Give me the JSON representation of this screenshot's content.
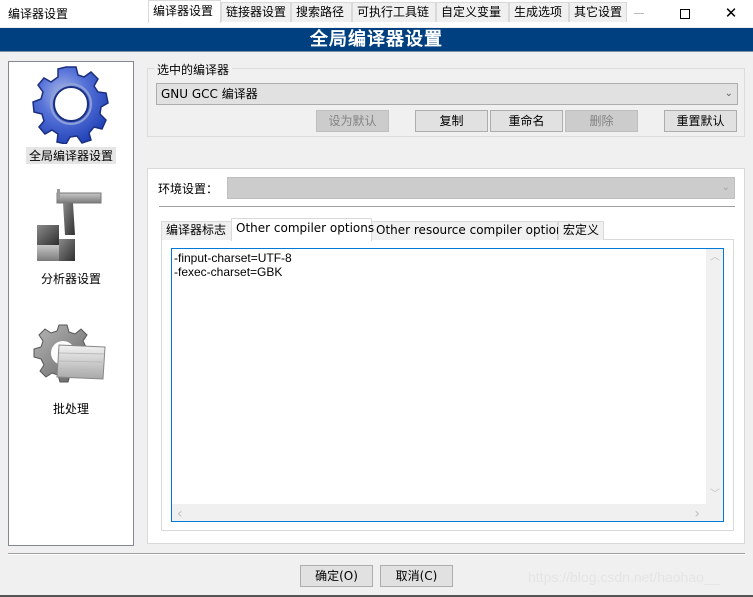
{
  "window": {
    "title": "编译器设置",
    "minimize_icon": "minimize-icon",
    "maximize_icon": "maximize-icon",
    "close_icon": "close-icon",
    "close_glyph": "✕"
  },
  "banner": {
    "title": "全局编译器设置"
  },
  "colors": {
    "banner": "#004080",
    "focus_border": "#0078d7"
  },
  "leftnav": {
    "items": [
      {
        "label": "全局编译器设置",
        "icon": "gear-icon",
        "selected": true
      },
      {
        "label": "分析器设置",
        "icon": "caliper-icon",
        "selected": false
      },
      {
        "label": "批处理",
        "icon": "batch-gear-icon",
        "selected": false
      }
    ]
  },
  "compiler_group": {
    "title": "选中的编译器",
    "selected_compiler": "GNU GCC 编译器",
    "chevron": "⌄",
    "buttons": {
      "set_default": "设为默认",
      "copy": "复制",
      "rename": "重命名",
      "delete": "删除",
      "reset_defaults": "重置默认"
    }
  },
  "main_tabs": [
    {
      "label": "编译器设置",
      "active": true
    },
    {
      "label": "链接器设置",
      "active": false
    },
    {
      "label": "搜索路径",
      "active": false
    },
    {
      "label": "可执行工具链",
      "active": false
    },
    {
      "label": "自定义变量",
      "active": false
    },
    {
      "label": "生成选项",
      "active": false
    },
    {
      "label": "其它设置",
      "active": false
    }
  ],
  "env": {
    "label": "环境设置：",
    "value": ""
  },
  "sub_tabs": [
    {
      "label": "编译器标志",
      "active": false
    },
    {
      "label": "Other compiler options",
      "active": true
    },
    {
      "label": "Other resource compiler options",
      "active": false
    },
    {
      "label": "宏定义",
      "active": false
    }
  ],
  "options_text": "-finput-charset=UTF-8\n-fexec-charset=GBK",
  "scroll_arrows": {
    "up": "︿",
    "down": "﹀",
    "left": "‹",
    "right": "›"
  },
  "footer": {
    "ok": "确定(O)",
    "cancel": "取消(C)",
    "watermark": "https://blog.csdn.net/haohao__"
  }
}
